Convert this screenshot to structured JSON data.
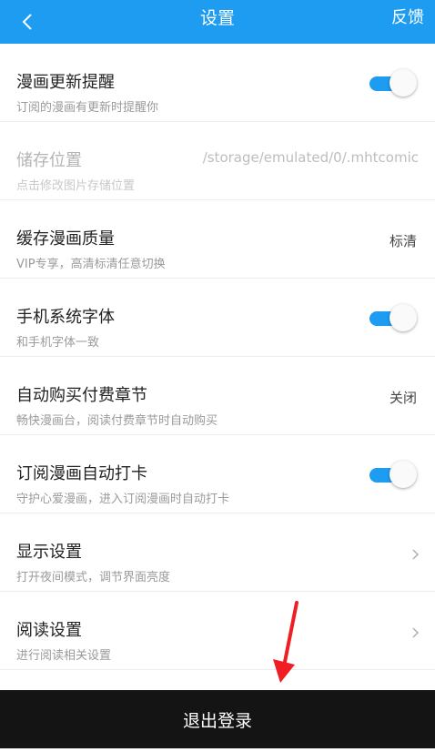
{
  "header": {
    "title": "设置",
    "feedback_label": "反馈",
    "background": "#1e9cf2"
  },
  "settings": [
    {
      "title": "漫画更新提醒",
      "subtitle": "订阅的漫画有更新时提醒你",
      "control": "toggle",
      "on": true
    },
    {
      "title": "储存位置",
      "subtitle": "点击修改图片存储位置",
      "value": "/storage/emulated/0/.mhtcomic",
      "disabled": true
    },
    {
      "title": "缓存漫画质量",
      "subtitle": "VIP专享，高清标清任意切换",
      "value": "标清"
    },
    {
      "title": "手机系统字体",
      "subtitle": "和手机字体一致",
      "control": "toggle",
      "on": true
    },
    {
      "title": "自动购买付费章节",
      "subtitle": "畅快漫画台，阅读付费章节时自动购买",
      "value": "关闭"
    },
    {
      "title": "订阅漫画自动打卡",
      "subtitle": "守护心爱漫画，进入订阅漫画时自动打卡",
      "control": "toggle",
      "on": true
    },
    {
      "title": "显示设置",
      "subtitle": "打开夜间模式，调节界面亮度",
      "control": "chevron"
    },
    {
      "title": "阅读设置",
      "subtitle": "进行阅读相关设置",
      "control": "chevron"
    }
  ],
  "logout_label": "退出登录",
  "colors": {
    "accent": "#1e9cf2",
    "annotation_arrow": "#f01e23",
    "bottom_bar": "#141414"
  }
}
